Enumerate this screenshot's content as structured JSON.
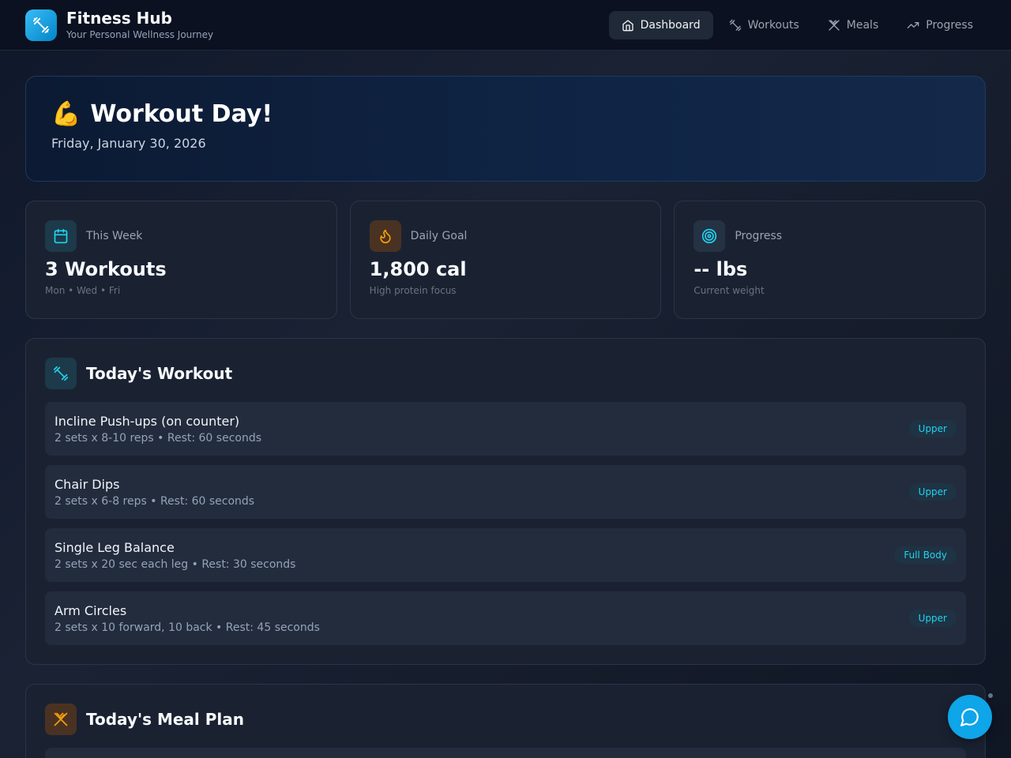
{
  "app": {
    "title": "Fitness Hub",
    "subtitle": "Your Personal Wellness Journey"
  },
  "nav": [
    {
      "label": "Dashboard",
      "icon": "home-icon",
      "active": true
    },
    {
      "label": "Workouts",
      "icon": "dumbbell-icon",
      "active": false
    },
    {
      "label": "Meals",
      "icon": "utensils-icon",
      "active": false
    },
    {
      "label": "Progress",
      "icon": "trending-up-icon",
      "active": false
    }
  ],
  "hero": {
    "emoji": "💪",
    "title": "Workout Day!",
    "date": "Friday, January 30, 2026"
  },
  "stats": [
    {
      "label": "This Week",
      "value": "3 Workouts",
      "sub": "Mon • Wed • Fri",
      "icon": "calendar-icon",
      "color": "#22d3ee"
    },
    {
      "label": "Daily Goal",
      "value": "1,800 cal",
      "sub": "High protein focus",
      "icon": "flame-icon",
      "color": "#f59e0b"
    },
    {
      "label": "Progress",
      "value": "-- lbs",
      "sub": "Current weight",
      "icon": "target-icon",
      "color": "#22d3ee"
    }
  ],
  "workout": {
    "title": "Today's Workout",
    "exercises": [
      {
        "name": "Incline Push-ups (on counter)",
        "detail": "2 sets x 8-10 reps • Rest: 60 seconds",
        "tag": "Upper"
      },
      {
        "name": "Chair Dips",
        "detail": "2 sets x 6-8 reps • Rest: 60 seconds",
        "tag": "Upper"
      },
      {
        "name": "Single Leg Balance",
        "detail": "2 sets x 20 sec each leg • Rest: 30 seconds",
        "tag": "Full Body"
      },
      {
        "name": "Arm Circles",
        "detail": "2 sets x 10 forward, 10 back • Rest: 45 seconds",
        "tag": "Upper"
      }
    ]
  },
  "meals": {
    "title": "Today's Meal Plan"
  },
  "colors": {
    "accent": "#0ea5e9",
    "tag_text": "#22d3ee",
    "meal_icon": "#f59e0b"
  }
}
